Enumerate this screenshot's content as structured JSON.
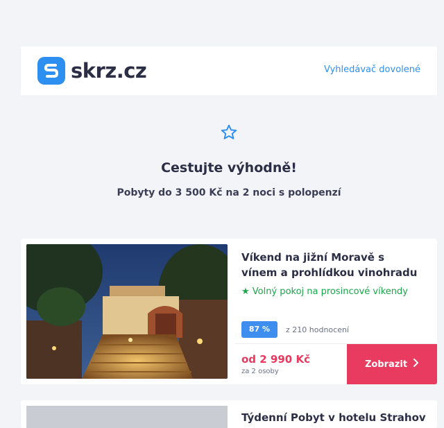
{
  "colors": {
    "accent": "#2d8ff0",
    "cta": "#e93b60",
    "price": "#e8385e",
    "available": "#1aa64a",
    "background": "#f3f4f8"
  },
  "header": {
    "logo_text": "skrz.cz",
    "nav_link": "Vyhledávač dovolené"
  },
  "hero": {
    "icon": "star-outline-icon",
    "title": "Cestujte výhodně!",
    "subtitle": "Pobyty do 3 500 Kč na 2 noci s polopenzí"
  },
  "offers": [
    {
      "title": "Víkend na jižní Moravě s vínem a prohlídkou vinohradu",
      "feature_icon": "star-icon",
      "feature": "Volný pokoj na prosincové víkendy",
      "rating": "87 %",
      "reviews": "z 210 hodnocení",
      "price": "od 2 990 Kč",
      "price_note": "za 2 osoby",
      "cta_label": "Zobrazit",
      "cta_icon": "chevron-right-icon"
    },
    {
      "title": "Týdenní Pobyt v hotelu Strahov"
    }
  ]
}
